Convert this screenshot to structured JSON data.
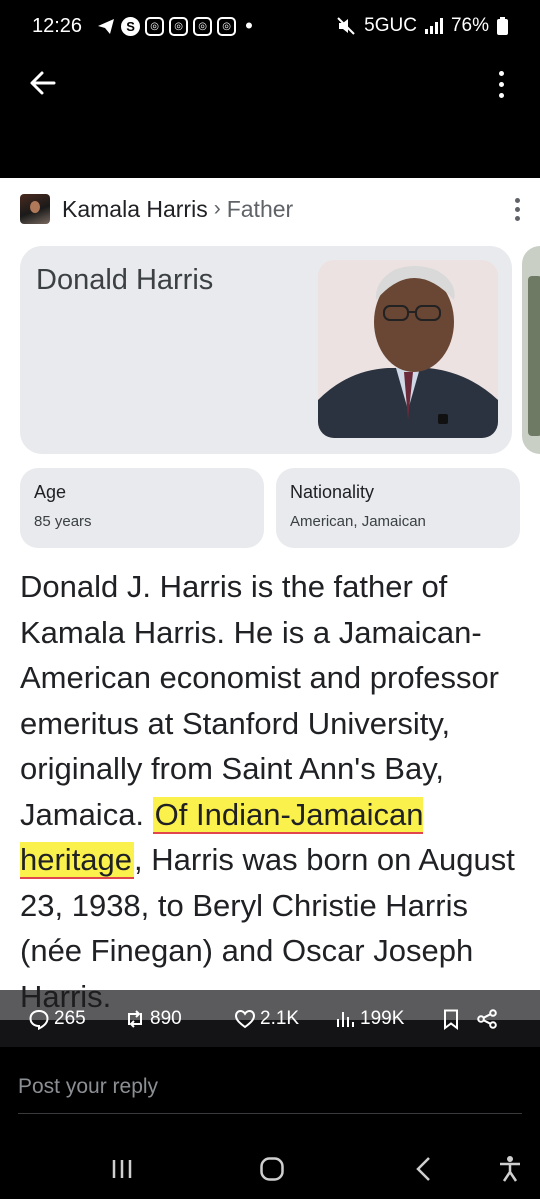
{
  "status_bar": {
    "time": "12:26",
    "network": "5GUC",
    "battery": "76%"
  },
  "breadcrumb": {
    "parent": "Kamala Harris",
    "separator": "›",
    "child": "Father"
  },
  "knowledge_card": {
    "name": "Donald Harris",
    "facts": [
      {
        "label": "Age",
        "value": "85 years"
      },
      {
        "label": "Nationality",
        "value": "American, Jamaican"
      }
    ]
  },
  "description": {
    "before_highlight": "Donald J. Harris is the father of Kamala Harris. He is a Jamaican-American economist and professor emeritus at Stanford University, originally from Saint Ann's Bay, Jamaica. ",
    "highlight": "Of Indian-Jamaican heritage",
    "after_highlight": ", Harris was born on August 23, 1938, to Beryl Christie Harris (née Finegan) and Oscar Joseph Harris."
  },
  "engagement": {
    "replies": "265",
    "reposts": "890",
    "likes": "2.1K",
    "views": "199K"
  },
  "reply": {
    "placeholder": "Post your reply"
  },
  "colors": {
    "highlight": "#fbf14d",
    "underline": "#e0464c",
    "card_bg": "#e8eaed"
  }
}
